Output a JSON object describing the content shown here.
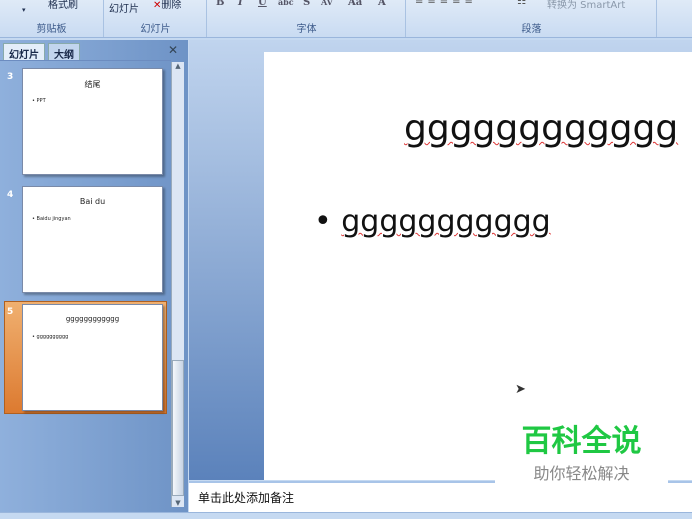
{
  "ribbon": {
    "groups": [
      {
        "label": "剪贴板"
      },
      {
        "label": "幻灯片"
      },
      {
        "label": "字体"
      },
      {
        "label": "段落"
      }
    ],
    "format_painter": "格式刷",
    "new_slide": "幻灯片",
    "delete": "删除",
    "smartart": "转换为 SmartArt",
    "font_buttons": [
      "B",
      "I",
      "U",
      "abc",
      "S",
      "AV",
      "Aa",
      "A"
    ]
  },
  "panel": {
    "tabs": [
      "幻灯片",
      "大纲"
    ],
    "close": "✕",
    "slides": [
      {
        "number": "3",
        "title": "结尾",
        "bullet": "PPT"
      },
      {
        "number": "4",
        "title": "Bai du",
        "bullet": "Baidu jingyan"
      },
      {
        "number": "5",
        "title": "gggggggggggg",
        "bullet": "gggggggggg",
        "selected": true
      }
    ]
  },
  "slide": {
    "title": "gggggggggggg",
    "bullet": "ggggggggggg"
  },
  "notes": {
    "placeholder": "单击此处添加备注"
  },
  "watermark": {
    "title": "百科全说",
    "subtitle": "助你轻松解决",
    "color": "#1fc843"
  }
}
